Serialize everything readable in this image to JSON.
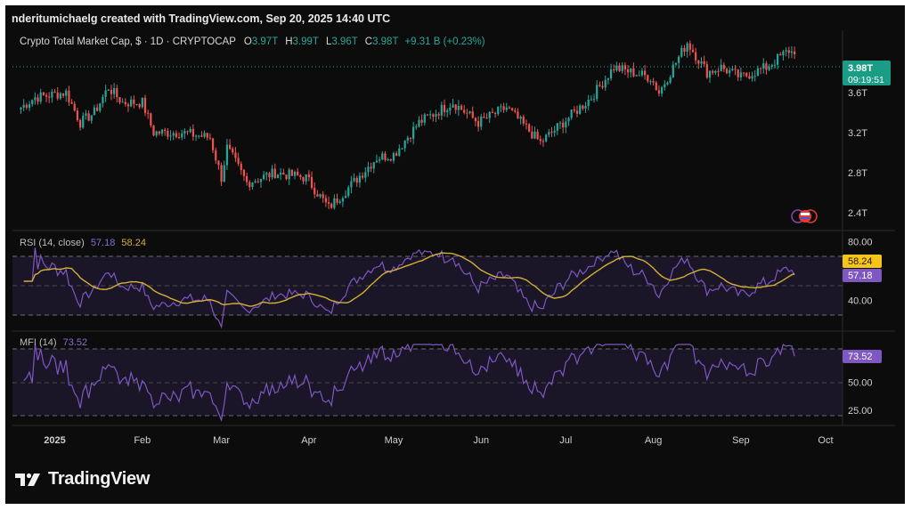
{
  "header": {
    "attribution": "nderitumichaelg created with TradingView.com, Sep 20, 2025 14:40 UTC"
  },
  "legend": {
    "symbol": "Crypto Total Market Cap, $ · 1D · CRYPTOCAP",
    "o_label": "O",
    "o_value": "3.97T",
    "h_label": "H",
    "h_value": "3.99T",
    "l_label": "L",
    "l_value": "3.96T",
    "c_label": "C",
    "c_value": "3.98T",
    "change": "+9.31 B (+0.23%)"
  },
  "price_badge": {
    "value": "3.98T",
    "countdown": "09:19:51"
  },
  "rsi": {
    "label": "RSI (14, close)",
    "rsi_value": "57.18",
    "ma_value": "58.24"
  },
  "mfi": {
    "label": "MFI (14)",
    "value": "73.52"
  },
  "footer": {
    "brand": "TradingView"
  },
  "colors": {
    "up": "#26a69a",
    "down": "#ef5350",
    "rsi": "#7e57c2",
    "rsi_ma": "#d4b036",
    "mfi": "#7e57c2",
    "badge": "#1b9c85"
  },
  "chart_data": [
    {
      "type": "candlestick",
      "title": "Crypto Total Market Cap, $ · 1D · CRYPTOCAP",
      "x_tick_labels": [
        "2025",
        "Feb",
        "Mar",
        "Apr",
        "May",
        "Jun",
        "Jul",
        "Aug",
        "Sep",
        "Oct"
      ],
      "y_tick_labels": [
        "3.6T",
        "3.2T",
        "2.8T",
        "2.4T"
      ],
      "y_ticks": [
        3.6,
        3.2,
        2.8,
        2.4
      ],
      "ylim": [
        2.25,
        4.22
      ],
      "y_unit": "T",
      "last_close": 3.98,
      "approx_close_path": [
        {
          "date": "2024-12-20",
          "close": 3.45
        },
        {
          "date": "2024-12-25",
          "close": 3.55
        },
        {
          "date": "2025-01-05",
          "close": 3.6
        },
        {
          "date": "2025-01-10",
          "close": 3.3
        },
        {
          "date": "2025-01-15",
          "close": 3.4
        },
        {
          "date": "2025-01-20",
          "close": 3.65
        },
        {
          "date": "2025-01-25",
          "close": 3.5
        },
        {
          "date": "2025-02-01",
          "close": 3.5
        },
        {
          "date": "2025-02-05",
          "close": 3.2
        },
        {
          "date": "2025-02-15",
          "close": 3.2
        },
        {
          "date": "2025-02-25",
          "close": 3.15
        },
        {
          "date": "2025-03-01",
          "close": 2.75
        },
        {
          "date": "2025-03-03",
          "close": 3.05
        },
        {
          "date": "2025-03-10",
          "close": 2.7
        },
        {
          "date": "2025-03-20",
          "close": 2.8
        },
        {
          "date": "2025-03-31",
          "close": 2.75
        },
        {
          "date": "2025-04-08",
          "close": 2.45
        },
        {
          "date": "2025-04-15",
          "close": 2.65
        },
        {
          "date": "2025-04-25",
          "close": 2.95
        },
        {
          "date": "2025-05-01",
          "close": 2.98
        },
        {
          "date": "2025-05-10",
          "close": 3.3
        },
        {
          "date": "2025-05-22",
          "close": 3.5
        },
        {
          "date": "2025-05-31",
          "close": 3.3
        },
        {
          "date": "2025-06-10",
          "close": 3.45
        },
        {
          "date": "2025-06-22",
          "close": 3.1
        },
        {
          "date": "2025-06-30",
          "close": 3.3
        },
        {
          "date": "2025-07-10",
          "close": 3.55
        },
        {
          "date": "2025-07-18",
          "close": 3.85
        },
        {
          "date": "2025-07-31",
          "close": 3.75
        },
        {
          "date": "2025-08-03",
          "close": 3.6
        },
        {
          "date": "2025-08-13",
          "close": 4.1
        },
        {
          "date": "2025-08-20",
          "close": 3.8
        },
        {
          "date": "2025-08-25",
          "close": 3.85
        },
        {
          "date": "2025-09-01",
          "close": 3.75
        },
        {
          "date": "2025-09-10",
          "close": 3.85
        },
        {
          "date": "2025-09-18",
          "close": 4.02
        },
        {
          "date": "2025-09-20",
          "close": 3.98
        }
      ]
    },
    {
      "type": "line",
      "title": "RSI (14, close)",
      "y_tick_labels": [
        "80.00",
        "40.00"
      ],
      "band": [
        30,
        70
      ],
      "ylim": [
        25,
        85
      ],
      "series": [
        {
          "name": "RSI",
          "last": 57.18
        },
        {
          "name": "RSI-based MA",
          "last": 58.24
        }
      ]
    },
    {
      "type": "line",
      "title": "MFI (14)",
      "y_tick_labels": [
        "50.00",
        "25.00"
      ],
      "band": [
        20,
        80
      ],
      "ylim": [
        15,
        85
      ],
      "series": [
        {
          "name": "MFI",
          "last": 73.52
        }
      ]
    }
  ]
}
